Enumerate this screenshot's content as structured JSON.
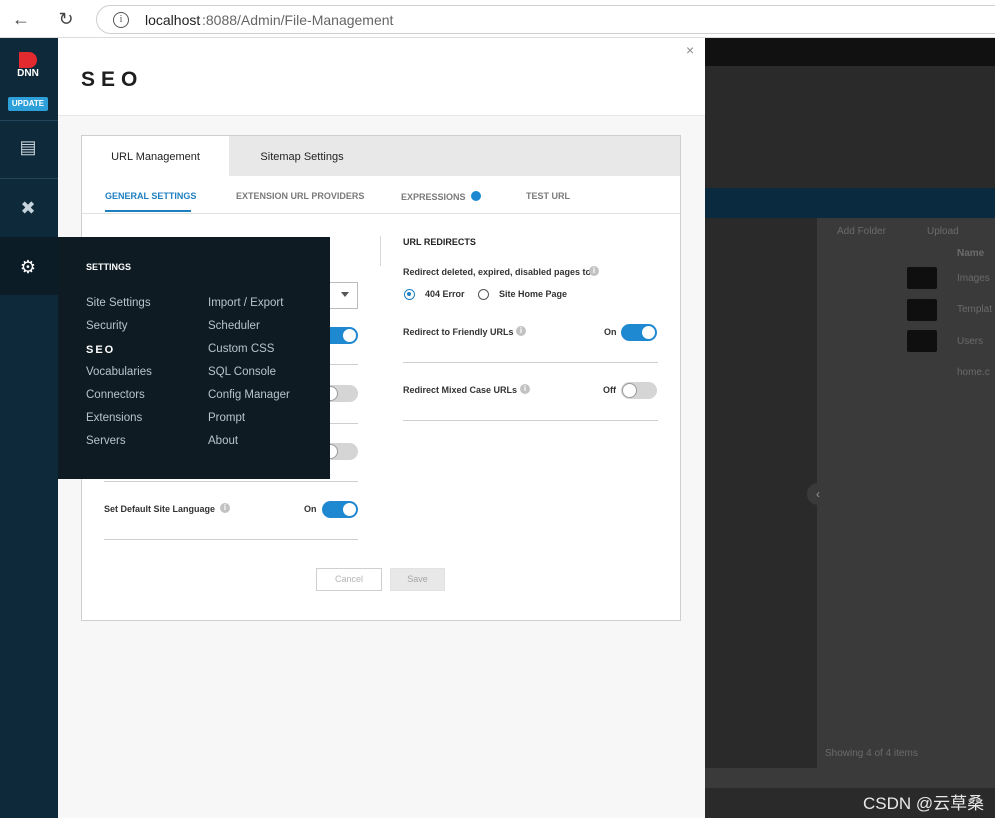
{
  "browser": {
    "url_host": "localhost",
    "url_rest": ":8088/Admin/File-Management",
    "back_icon": "←",
    "reload_icon": "↻"
  },
  "rail": {
    "logo_text": "DNN",
    "update_badge": "UPDATE",
    "icons": [
      "content-icon",
      "tools-icon",
      "gear-icon"
    ]
  },
  "panel": {
    "title": "SEO",
    "close": "×",
    "tabs": [
      {
        "label": "URL Management"
      },
      {
        "label": "Sitemap Settings"
      }
    ],
    "subtabs": [
      {
        "label": "GENERAL SETTINGS"
      },
      {
        "label": "EXTENSION URL PROVIDERS"
      },
      {
        "label": "EXPRESSIONS"
      },
      {
        "label": "TEST URL"
      }
    ],
    "left": {
      "set_default_language_label": "Set Default Site Language",
      "set_default_language_state": "On"
    },
    "redirects": {
      "title": "URL REDIRECTS",
      "redirect_deleted_label": "Redirect deleted, expired, disabled pages to",
      "option_404": "404 Error",
      "option_home": "Site Home Page",
      "friendly_label": "Redirect to Friendly URLs",
      "friendly_state": "On",
      "mixed_label": "Redirect Mixed Case URLs",
      "mixed_state": "Off"
    },
    "buttons": {
      "cancel": "Cancel",
      "save": "Save"
    }
  },
  "flyout": {
    "title": "SETTINGS",
    "col1": [
      "Site Settings",
      "Security",
      "SEO",
      "Vocabularies",
      "Connectors",
      "Extensions",
      "Servers"
    ],
    "col2": [
      "Import / Export",
      "Scheduler",
      "Custom CSS",
      "SQL Console",
      "Config Manager",
      "Prompt",
      "About"
    ]
  },
  "background": {
    "add_folder": "Add Folder",
    "upload": "Upload",
    "col_name": "Name",
    "rows": [
      "Images",
      "Templat",
      "Users",
      "home.c"
    ],
    "footer": "Showing 4 of 4 items"
  },
  "watermark": "CSDN @云草桑"
}
